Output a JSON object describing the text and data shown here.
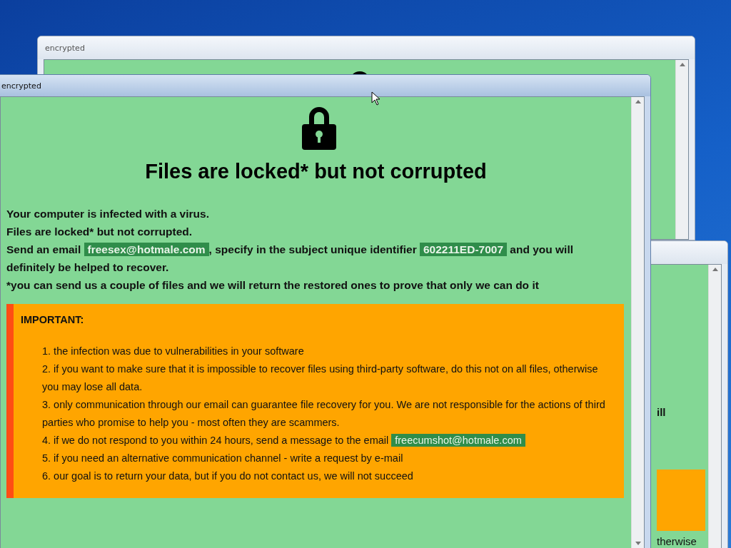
{
  "back_window": {
    "title": "encrypted"
  },
  "side_window": {
    "fragments": [
      "ill",
      "therwise"
    ]
  },
  "front_window": {
    "title": "encrypted",
    "heading": "Files are locked* but not corrupted",
    "message": [
      [
        {
          "kind": "plain",
          "text": "Your computer is infected with a virus."
        }
      ],
      [
        {
          "kind": "plain",
          "text": "Files are locked* but not corrupted."
        }
      ],
      [
        {
          "kind": "plain",
          "text": "Send an email "
        },
        {
          "kind": "highlight",
          "text": "freesex@hotmale.com"
        },
        {
          "kind": "plain",
          "text": ", specify in the subject unique identifier "
        },
        {
          "kind": "highlight",
          "text": "602211ED-7007"
        },
        {
          "kind": "plain",
          "text": " and you will definitely be helped to recover."
        }
      ],
      [
        {
          "kind": "plain",
          "text": "*you can send us a couple of files and we will return the restored ones to prove that only we can do it"
        }
      ]
    ],
    "important": {
      "label": "IMPORTANT:",
      "items": [
        [
          {
            "kind": "plain",
            "text": "1. the infection was due to vulnerabilities in your software"
          }
        ],
        [
          {
            "kind": "plain",
            "text": "2. if you want to make sure that it is impossible to recover files using third-party software, do this not on all files, otherwise you may lose all data."
          }
        ],
        [
          {
            "kind": "plain",
            "text": "3. only communication through our email can guarantee file recovery for you. We are not responsible for the actions of third parties who promise to help you - most often they are scammers."
          }
        ],
        [
          {
            "kind": "plain",
            "text": "4. if we do not respond to you within 24 hours, send a message to the email "
          },
          {
            "kind": "highlight",
            "text": "freecumshot@hotmale.com"
          }
        ],
        [
          {
            "kind": "plain",
            "text": "5. if you need an alternative communication channel - write a request by e-mail"
          }
        ],
        [
          {
            "kind": "plain",
            "text": "6. our goal is to return your data, but if you do not contact us, we will not succeed"
          }
        ]
      ]
    }
  }
}
